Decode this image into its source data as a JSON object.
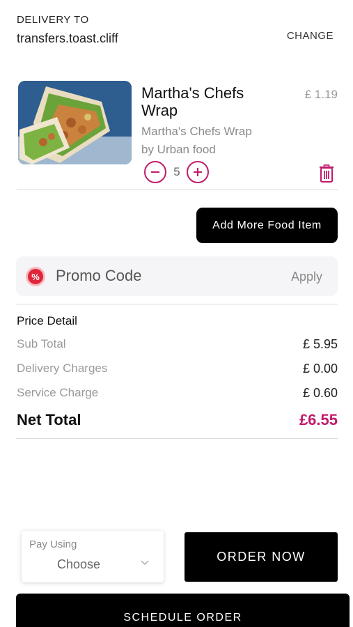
{
  "header": {
    "delivery_label": "DELIVERY TO",
    "address": "transfers.toast.cliff",
    "change_label": "CHANGE"
  },
  "cart_item": {
    "name": "Martha's Chefs Wrap",
    "description": "Martha's Chefs Wrap",
    "vendor": "by Urban food",
    "price": "£ 1.19",
    "quantity": "5",
    "image_icon": "wrap-food-photo",
    "delete_icon": "trash-icon"
  },
  "actions": {
    "add_more_label": "Add More Food Item"
  },
  "promo": {
    "icon": "%",
    "label": "Promo Code",
    "apply_label": "Apply"
  },
  "price_detail": {
    "title": "Price Detail",
    "rows": [
      {
        "label": "Sub Total",
        "value": "£ 5.95"
      },
      {
        "label": "Delivery Charges",
        "value": "£ 0.00"
      },
      {
        "label": "Service Charge",
        "value": "£ 0.60"
      }
    ],
    "net_total_label": "Net Total",
    "net_total_value": "£6.55"
  },
  "footer": {
    "pay_using_label": "Pay Using",
    "pay_using_value": "Choose",
    "order_now_label": "ORDER NOW",
    "schedule_order_label": "SCHEDULE ORDER"
  },
  "colors": {
    "accent": "#c01b6a",
    "primary_button": "#000000",
    "promo_icon": "#e0243a"
  }
}
